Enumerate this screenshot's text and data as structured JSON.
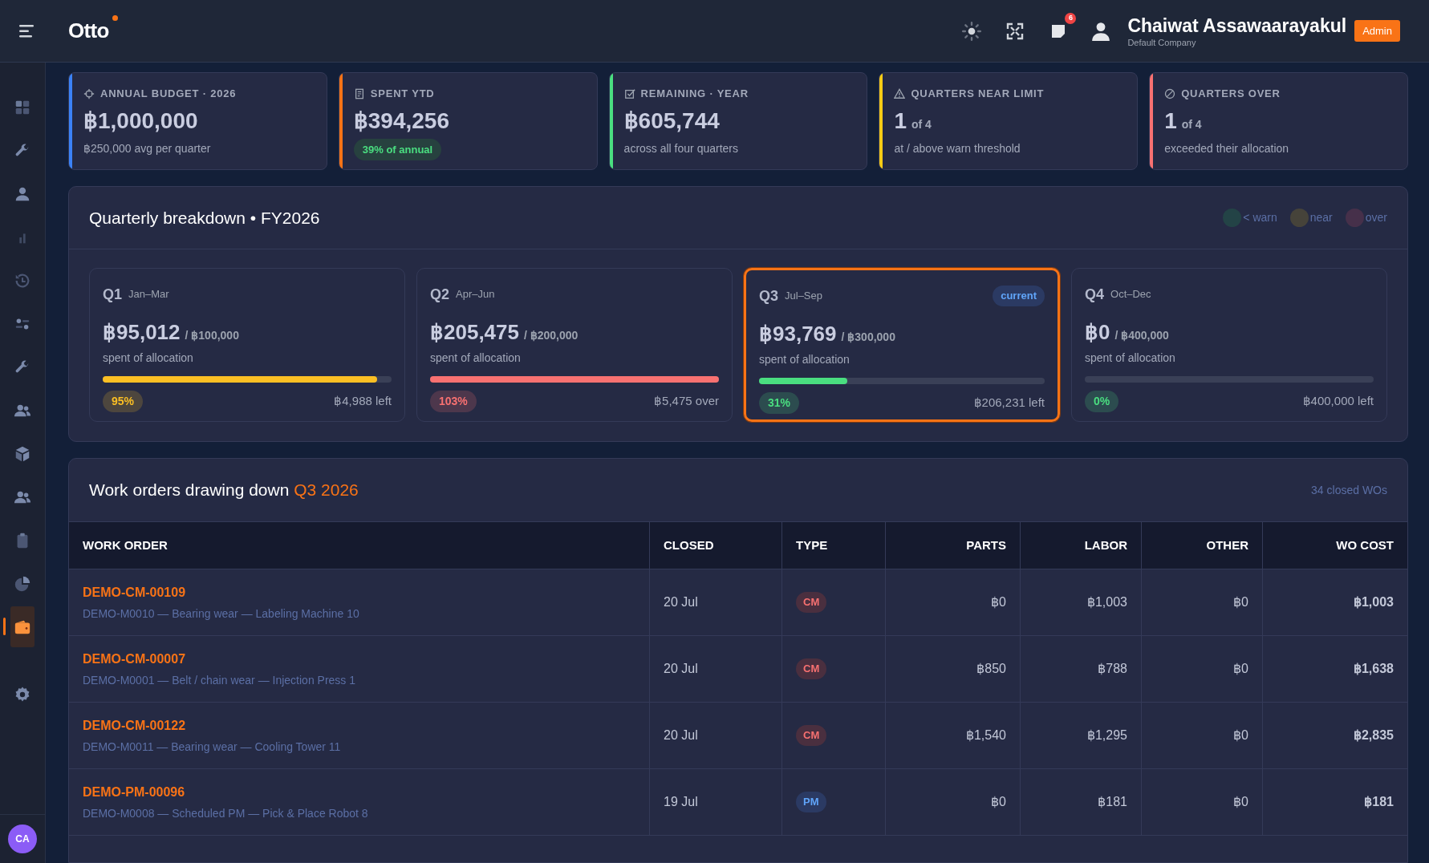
{
  "topbar": {
    "logo": "Otto",
    "notification_count": "6",
    "user_name": "Chaiwat Assawaarayakul",
    "company": "Default Company",
    "role": "Admin"
  },
  "sidebar": {
    "items": [
      {
        "selected": false
      },
      {
        "selected": false
      },
      {
        "selected": false
      },
      {
        "selected": false
      },
      {
        "selected": false
      },
      {
        "selected": false
      },
      {
        "selected": false
      },
      {
        "selected": false
      },
      {
        "selected": false
      },
      {
        "selected": false
      },
      {
        "selected": false
      },
      {
        "selected": false
      },
      {
        "selected": true
      },
      {
        "selected": false
      }
    ],
    "avatar": "CA"
  },
  "kpis": [
    {
      "label": "ANNUAL BUDGET · 2026",
      "value": "฿1,000,000",
      "note": "฿250,000 avg per quarter",
      "color": "#3b82f6"
    },
    {
      "label": "SPENT YTD",
      "value": "฿394,256",
      "pill": "39% of annual",
      "color": "#f97316"
    },
    {
      "label": "REMAINING · YEAR",
      "value": "฿605,744",
      "note": "across all four quarters",
      "color": "#4ade80"
    },
    {
      "label": "QUARTERS NEAR LIMIT",
      "value": "1",
      "suffix": "of 4",
      "note": "at / above warn threshold",
      "color": "#facc15"
    },
    {
      "label": "QUARTERS OVER",
      "value": "1",
      "suffix": "of 4",
      "note": "exceeded their allocation",
      "color": "#f87171"
    }
  ],
  "quarterly": {
    "title": "Quarterly breakdown • FY2026",
    "legend": [
      {
        "label": "< warn",
        "color": "#234346"
      },
      {
        "label": "near",
        "color": "#46433a"
      },
      {
        "label": "over",
        "color": "#46304a"
      }
    ],
    "quarters": [
      {
        "name": "Q1",
        "months": "Jan–Mar",
        "spent": "฿95,012",
        "allocation": "/ ฿100,000",
        "caption": "spent of allocation",
        "level": 0.95,
        "kind": "near",
        "percent": "95%",
        "remaining": "฿4,988 left",
        "selected": false
      },
      {
        "name": "Q2",
        "months": "Apr–Jun",
        "spent": "฿205,475",
        "allocation": "/ ฿200,000",
        "caption": "spent of allocation",
        "level": 1,
        "kind": "over",
        "percent": "103%",
        "remaining": "฿5,475 over",
        "selected": false
      },
      {
        "name": "Q3",
        "months": "Jul–Sep",
        "badge": "current",
        "spent": "฿93,769",
        "allocation": "/ ฿300,000",
        "caption": "spent of allocation",
        "level": 0.31,
        "kind": "ok",
        "percent": "31%",
        "remaining": "฿206,231 left",
        "selected": true
      },
      {
        "name": "Q4",
        "months": "Oct–Dec",
        "spent": "฿0",
        "allocation": "/ ฿400,000",
        "caption": "spent of allocation",
        "level": 0,
        "kind": "ok",
        "percent": "0%",
        "remaining": "฿400,000 left",
        "selected": false
      }
    ]
  },
  "work_orders": {
    "title": "Work orders drawing down",
    "title_highlight": "Q3 2026",
    "count": "34 closed WOs",
    "columns": [
      "WORK ORDER",
      "CLOSED",
      "TYPE",
      "PARTS",
      "LABOR",
      "OTHER",
      "WO COST"
    ],
    "rows": [
      {
        "work_order": "DEMO-CM-00109",
        "description": "DEMO-M0010 — Bearing wear — Labeling Machine 10",
        "closed": "20 Jul",
        "type": {
          "label": "CM",
          "kind": "corrective"
        },
        "parts": "฿0",
        "labor": "฿1,003",
        "other": "฿0",
        "wo_cost": "฿1,003"
      },
      {
        "work_order": "DEMO-CM-00007",
        "description": "DEMO-M0001 — Belt / chain wear — Injection Press 1",
        "closed": "20 Jul",
        "type": {
          "label": "CM",
          "kind": "corrective"
        },
        "parts": "฿850",
        "labor": "฿788",
        "other": "฿0",
        "wo_cost": "฿1,638"
      },
      {
        "work_order": "DEMO-CM-00122",
        "description": "DEMO-M0011 — Bearing wear — Cooling Tower 11",
        "closed": "20 Jul",
        "type": {
          "label": "CM",
          "kind": "corrective"
        },
        "parts": "฿1,540",
        "labor": "฿1,295",
        "other": "฿0",
        "wo_cost": "฿2,835"
      },
      {
        "work_order": "DEMO-PM-00096",
        "description": "DEMO-M0008 — Scheduled PM — Pick & Place Robot 8",
        "closed": "19 Jul",
        "type": {
          "label": "PM",
          "kind": "preventive"
        },
        "parts": "฿0",
        "labor": "฿181",
        "other": "฿0",
        "wo_cost": "฿181"
      }
    ]
  }
}
